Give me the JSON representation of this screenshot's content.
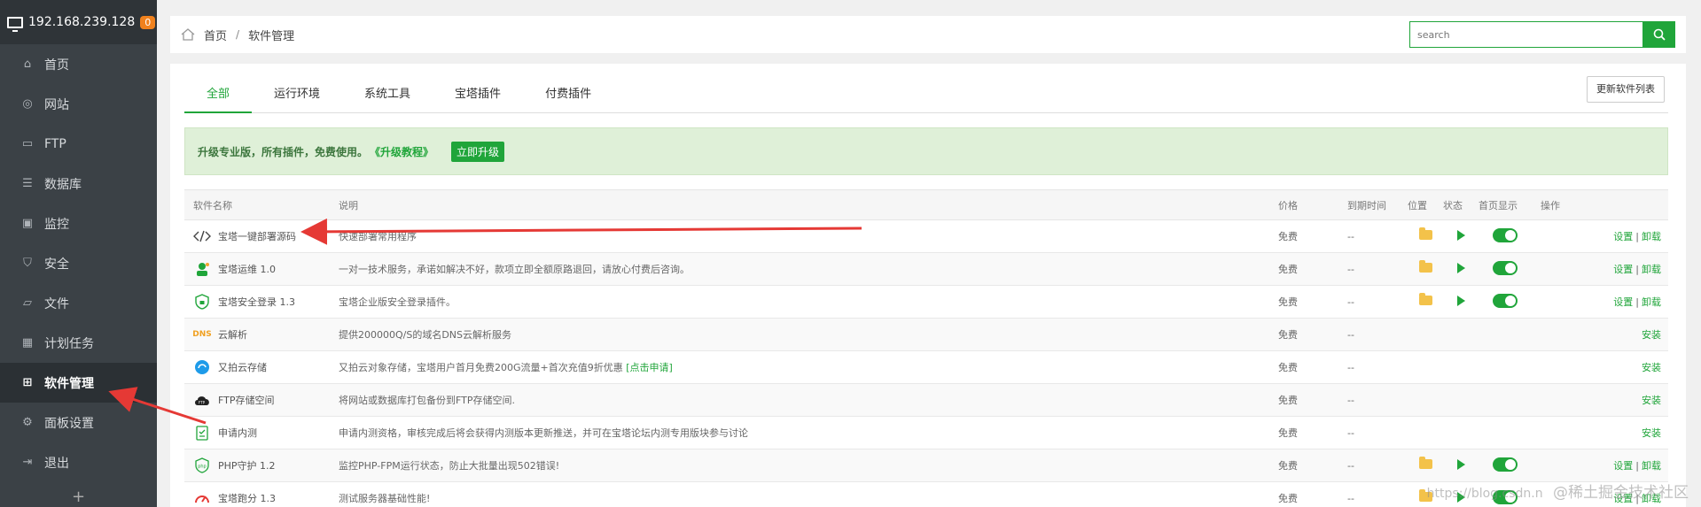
{
  "sidebar": {
    "host": "192.168.239.128",
    "badge": "0",
    "items": [
      {
        "label": "首页",
        "icon": "home-icon"
      },
      {
        "label": "网站",
        "icon": "globe-icon"
      },
      {
        "label": "FTP",
        "icon": "ftp-icon"
      },
      {
        "label": "数据库",
        "icon": "database-icon"
      },
      {
        "label": "监控",
        "icon": "monitor-icon"
      },
      {
        "label": "安全",
        "icon": "shield-icon"
      },
      {
        "label": "文件",
        "icon": "folder-icon"
      },
      {
        "label": "计划任务",
        "icon": "calendar-icon"
      },
      {
        "label": "软件管理",
        "icon": "grid-icon",
        "active": true
      },
      {
        "label": "面板设置",
        "icon": "gear-icon"
      },
      {
        "label": "退出",
        "icon": "logout-icon"
      }
    ],
    "plus": "+"
  },
  "breadcrumb": {
    "home": "首页",
    "sep": "/",
    "current": "软件管理"
  },
  "search": {
    "placeholder": "search"
  },
  "tabs": [
    "全部",
    "运行环境",
    "系统工具",
    "宝塔插件",
    "付费插件"
  ],
  "update_button": "更新软件列表",
  "upgrade": {
    "text": "升级专业版，所有插件，免费使用。",
    "link": "《升级教程》",
    "button": "立即升级"
  },
  "table": {
    "headers": {
      "name": "软件名称",
      "desc": "说明",
      "price": "价格",
      "expire": "到期时间",
      "location": "位置",
      "status": "状态",
      "home": "首页显示",
      "action": "操作"
    },
    "rows": [
      {
        "name": "宝塔一键部署源码",
        "desc": "快速部署常用程序",
        "price": "免费",
        "expire": "--",
        "installed": true,
        "icon": "code-icon"
      },
      {
        "name": "宝塔运维 1.0",
        "desc": "一对一技术服务，承诺如解决不好，款项立即全额原路退回，请放心付费后咨询。",
        "price": "免费",
        "expire": "--",
        "installed": true,
        "icon": "support-agent-icon"
      },
      {
        "name": "宝塔安全登录 1.3",
        "desc": "宝塔企业版安全登录插件。",
        "price": "免费",
        "expire": "--",
        "installed": true,
        "icon": "lock-shield-icon"
      },
      {
        "name": "云解析",
        "desc": "提供200000Q/S的域名DNS云解析服务",
        "price": "免费",
        "expire": "--",
        "installed": false,
        "icon": "dns-icon"
      },
      {
        "name": "又拍云存储",
        "desc": "又拍云对象存储，宝塔用户首月免费200G流量+首次充值9折优惠",
        "desc_link": "[点击申请]",
        "price": "免费",
        "expire": "--",
        "installed": false,
        "icon": "upyun-icon"
      },
      {
        "name": "FTP存储空间",
        "desc": "将网站或数据库打包备份到FTP存储空间.",
        "price": "免费",
        "expire": "--",
        "installed": false,
        "icon": "ftp-cloud-icon"
      },
      {
        "name": "申请内测",
        "desc": "申请内测资格，审核完成后将会获得内测版本更新推送，并可在宝塔论坛内测专用版块参与讨论",
        "price": "免费",
        "expire": "--",
        "installed": false,
        "icon": "clipboard-icon"
      },
      {
        "name": "PHP守护 1.2",
        "desc": "监控PHP-FPM运行状态，防止大批量出现502错误!",
        "price": "免费",
        "expire": "--",
        "installed": true,
        "icon": "php-icon"
      },
      {
        "name": "宝塔跑分 1.3",
        "desc": "测试服务器基础性能!",
        "price": "免费",
        "expire": "--",
        "installed": true,
        "icon": "speedometer-icon"
      }
    ],
    "action_settings": "设置",
    "action_uninstall": "卸载",
    "action_sep": "|",
    "action_install": "安装"
  },
  "watermark": {
    "url": "https://blog.csdn.n",
    "text": "@稀土掘金技术社区"
  },
  "colors": {
    "accent": "#20a53a",
    "sidebar_bg": "#3b4146",
    "arrow": "#e53935"
  }
}
